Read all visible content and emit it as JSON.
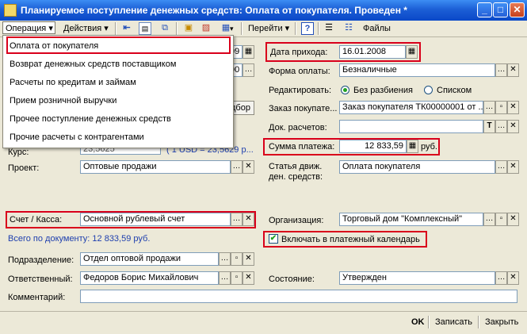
{
  "window": {
    "title": "Планируемое поступление денежных средств: Оплата от покупателя. Проведен *",
    "minimize": "_",
    "maximize": "□",
    "close": "✕"
  },
  "toolbar": {
    "operation": "Операция ▾",
    "actions": "Действия ▾",
    "goto": "Перейти ▾",
    "help": "?",
    "files": "Файлы"
  },
  "operation_menu": {
    "items": [
      "Оплата от покупателя",
      "Возврат денежных средств поставщиком",
      "Расчеты по кредитам и займам",
      "Прием розничной выручки",
      "Прочее поступление денежных средств",
      "Прочие расчеты с контрагентами"
    ],
    "selected_index": 0
  },
  "left": {
    "partial_top1": "09",
    "partial_top2": "00",
    "selection_button": "дбор",
    "rate_label": "Курс:",
    "rate_partial": "23,5625",
    "rate_hint": "( 1 USD = 23,5629 р...",
    "project_label": "Проект:",
    "project_value": "Оптовые продажи",
    "account_label": "Счет / Касса:",
    "account_value": "Основной рублевый счет",
    "total_text": "Всего по документу: 12 833,59 руб.",
    "department_label": "Подразделение:",
    "department_value": "Отдел оптовой продажи",
    "responsible_label": "Ответственный:",
    "responsible_value": "Федоров Борис Михайлович",
    "comment_label": "Комментарий:",
    "comment_value": ""
  },
  "right": {
    "arrival_date_label": "Дата прихода:",
    "arrival_date_value": "16.01.2008",
    "payment_form_label": "Форма оплаты:",
    "payment_form_value": "Безналичные",
    "edit_label": "Редактировать:",
    "edit_option1": "Без разбиения",
    "edit_option2": "Списком",
    "edit_selected": "Без разбиения",
    "order_label": "Заказ покупате...",
    "order_value": "Заказ покупателя ТК00000001 от ...",
    "settlement_doc_label": "Док. расчетов:",
    "settlement_doc_value": "",
    "payment_sum_label": "Сумма платежа:",
    "payment_sum_value": "12 833,59",
    "payment_sum_currency": "руб.",
    "cashflow_label_1": "Статья движ.",
    "cashflow_label_2": "ден. средств:",
    "cashflow_value": "Оплата покупателя",
    "organization_label": "Организация:",
    "organization_value": "Торговый дом \"Комплексный\"",
    "calendar_checkbox_label": "Включать в платежный календарь",
    "calendar_checked": true,
    "state_label": "Состояние:",
    "state_value": "Утвержден"
  },
  "bottom": {
    "ok": "OK",
    "save": "Записать",
    "close": "Закрыть"
  },
  "colors": {
    "highlight": "#d9001b",
    "title_bar": "#0a48c8",
    "total_text": "#1e3fae"
  }
}
